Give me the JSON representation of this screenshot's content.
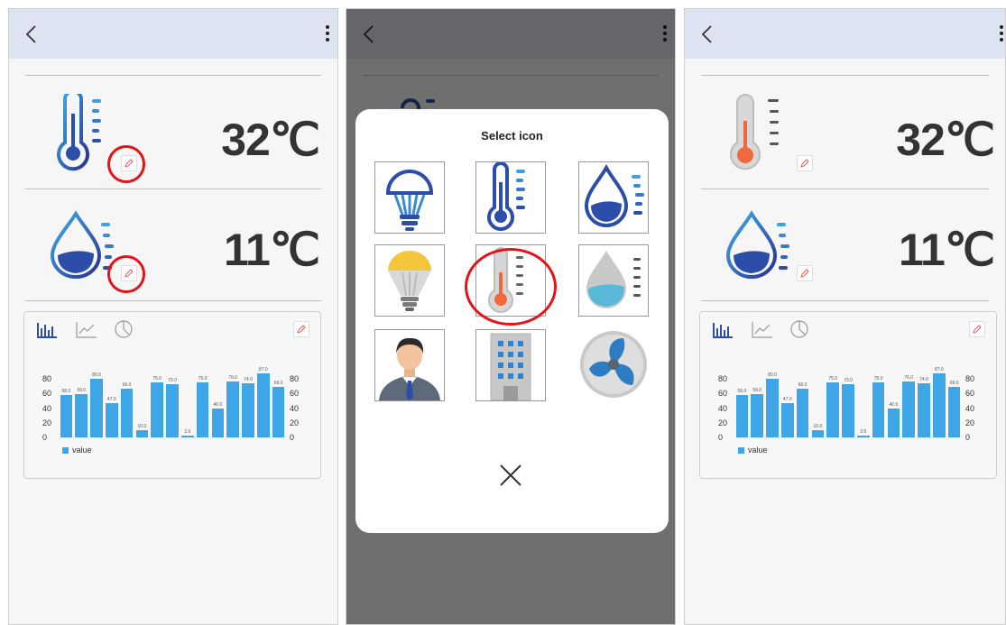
{
  "panels": [
    {
      "id": "before",
      "reading1": "32℃",
      "reading2": "11℃"
    },
    {
      "id": "picker"
    },
    {
      "id": "after",
      "reading1": "32℃",
      "reading2": "11℃"
    }
  ],
  "dialog": {
    "title": "Select icon",
    "icons": [
      "bulb-outline-icon",
      "thermometer-outline-icon",
      "water-drop-outline-icon",
      "bulb-yellow-icon",
      "thermometer-gray-icon",
      "water-drop-gray-icon",
      "businessman-icon",
      "office-building-icon",
      "fan-icon"
    ]
  },
  "colors": {
    "accent_blue": "#2d4ea8",
    "bar_blue": "#3ea6e6",
    "highlight_red": "#e2141a",
    "appbar": "#dde3f0"
  },
  "chart_data": {
    "type": "bar",
    "values": [
      58.0,
      59.0,
      80.0,
      47.0,
      66.0,
      10.0,
      75.0,
      73.0,
      2.0,
      75.0,
      40.0,
      76.0,
      74.0,
      87.0,
      69.0
    ],
    "value_labels": [
      "58.0",
      "59.0",
      "80.0",
      "47.0",
      "66.0",
      "10.0",
      "75.0",
      "73.0",
      "2.0",
      "75.0",
      "40.0",
      "76.0",
      "74.0",
      "87.0",
      "69.0"
    ],
    "ylim": [
      0,
      80
    ],
    "yticks": [
      "80",
      "60",
      "40",
      "20",
      "0"
    ],
    "legend": "value",
    "legend_position": "bottom-left",
    "grid": false
  }
}
